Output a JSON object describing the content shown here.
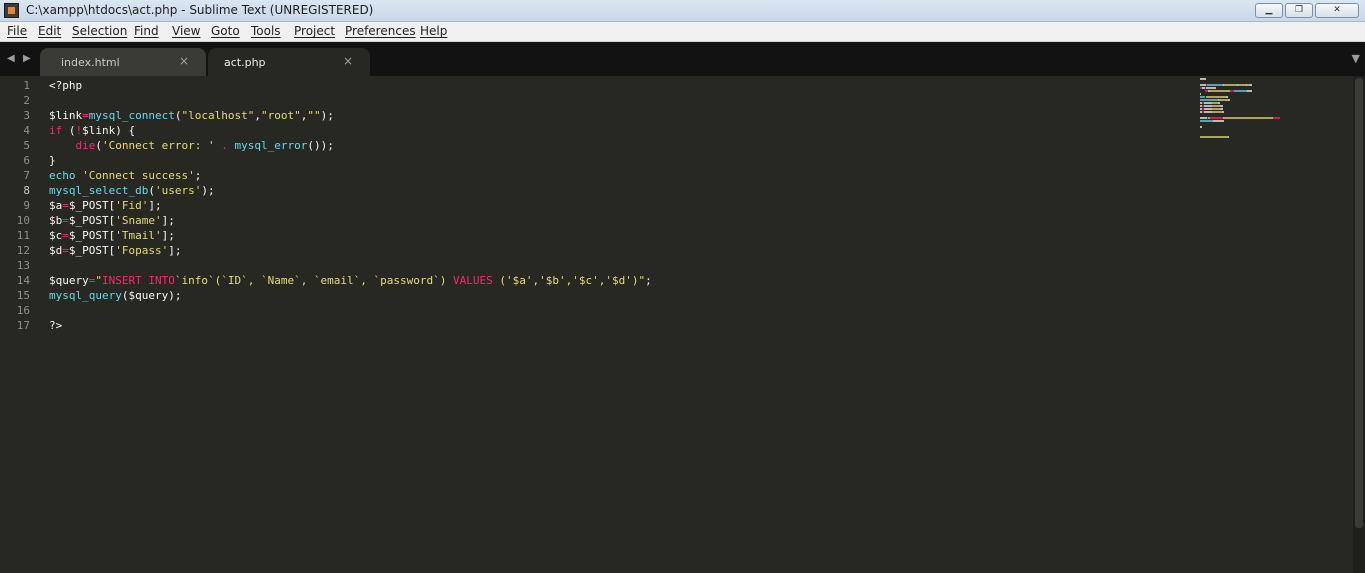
{
  "window": {
    "title": "C:\\xampp\\htdocs\\act.php - Sublime Text (UNREGISTERED)",
    "buttons": {
      "minimize": "▁",
      "maximize": "❐",
      "close": "✕"
    }
  },
  "menu": [
    "File",
    "Edit",
    "Selection",
    "Find",
    "View",
    "Goto",
    "Tools",
    "Project",
    "Preferences",
    "Help"
  ],
  "tabs": [
    {
      "label": "index.html",
      "active": false
    },
    {
      "label": "act.php",
      "active": true
    }
  ],
  "tab_close_glyph": "×",
  "nav": {
    "back": "◀",
    "forward": "▶",
    "overflow": "▼"
  },
  "editor": {
    "current_line": 8,
    "line_numbers": [
      "1",
      "2",
      "3",
      "4",
      "5",
      "6",
      "7",
      "8",
      "9",
      "10",
      "11",
      "12",
      "13",
      "14",
      "15",
      "16",
      "17"
    ],
    "colors": {
      "background": "#272822",
      "text": "#f8f8f2",
      "keyword": "#f92672",
      "function": "#66d9ef",
      "string": "#e6db74",
      "line_number": "#8f908a"
    },
    "lines": [
      [
        [
          "<?php",
          "text"
        ]
      ],
      [],
      [
        [
          "$link",
          "text"
        ],
        [
          "=",
          "keyword"
        ],
        [
          "mysql_connect",
          "function"
        ],
        [
          "(",
          "text"
        ],
        [
          "\"localhost\"",
          "string"
        ],
        [
          ",",
          "text"
        ],
        [
          "\"root\"",
          "string"
        ],
        [
          ",",
          "text"
        ],
        [
          "\"\"",
          "string"
        ],
        [
          ");",
          "text"
        ]
      ],
      [
        [
          "if",
          "keyword"
        ],
        [
          " (",
          "text"
        ],
        [
          "!",
          "keyword"
        ],
        [
          "$link) {",
          "text"
        ]
      ],
      [
        [
          "    ",
          "text"
        ],
        [
          "die",
          "keyword"
        ],
        [
          "(",
          "text"
        ],
        [
          "'Connect error: '",
          "string"
        ],
        [
          " . ",
          "keyword"
        ],
        [
          "mysql_error",
          "function"
        ],
        [
          "());",
          "text"
        ]
      ],
      [
        [
          "}",
          "text"
        ]
      ],
      [
        [
          "echo",
          "function"
        ],
        [
          " ",
          "text"
        ],
        [
          "'Connect success'",
          "string"
        ],
        [
          ";",
          "text"
        ]
      ],
      [
        [
          "mysql_select_db",
          "function"
        ],
        [
          "(",
          "text"
        ],
        [
          "'users'",
          "string"
        ],
        [
          ");",
          "text"
        ]
      ],
      [
        [
          "$a",
          "text"
        ],
        [
          "=",
          "keyword"
        ],
        [
          "$_POST[",
          "text"
        ],
        [
          "'Fid'",
          "string"
        ],
        [
          "];",
          "text"
        ]
      ],
      [
        [
          "$b",
          "text"
        ],
        [
          "=",
          "keyword"
        ],
        [
          "$_POST[",
          "text"
        ],
        [
          "'Sname'",
          "string"
        ],
        [
          "];",
          "text"
        ]
      ],
      [
        [
          "$c",
          "text"
        ],
        [
          "=",
          "keyword"
        ],
        [
          "$_POST[",
          "text"
        ],
        [
          "'Tmail'",
          "string"
        ],
        [
          "];",
          "text"
        ]
      ],
      [
        [
          "$d",
          "text"
        ],
        [
          "=",
          "keyword"
        ],
        [
          "$_POST[",
          "text"
        ],
        [
          "'Fopass'",
          "string"
        ],
        [
          "];",
          "text"
        ]
      ],
      [],
      [
        [
          "$query",
          "text"
        ],
        [
          "=",
          "keyword"
        ],
        [
          "\"",
          "string"
        ],
        [
          "INSERT INTO",
          "keyword"
        ],
        [
          "`info`(`ID`, `Name`, `email`, `password`) ",
          "string"
        ],
        [
          "VALUES",
          "keyword"
        ],
        [
          " ('$a','$b','$c','$d')\"",
          "string"
        ],
        [
          ";",
          "text"
        ]
      ],
      [
        [
          "mysql_query",
          "function"
        ],
        [
          "($query);",
          "text"
        ]
      ],
      [],
      [
        [
          "?>",
          "text"
        ]
      ]
    ]
  }
}
